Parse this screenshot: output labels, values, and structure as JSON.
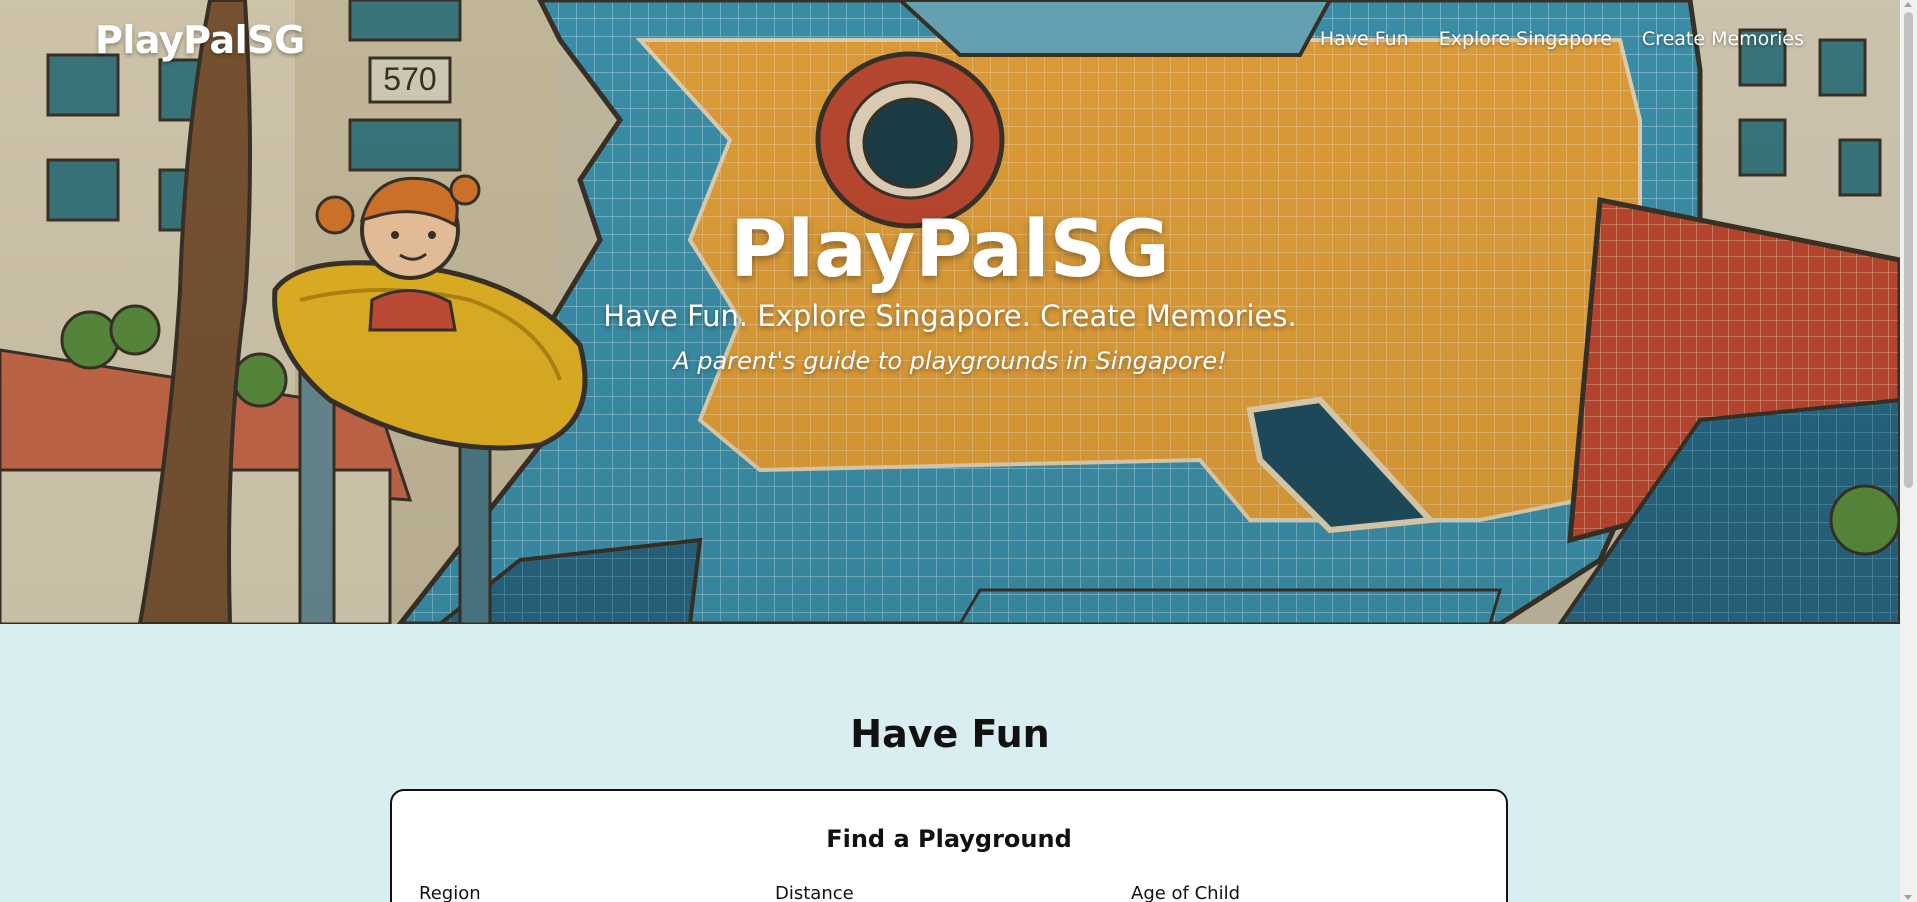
{
  "nav": {
    "brand": "PlayPalSG",
    "links": [
      "Have Fun",
      "Explore Singapore",
      "Create Memories"
    ]
  },
  "hero": {
    "title": "PlayPalSG",
    "subtitle": "Have Fun. Explore Singapore. Create Memories.",
    "tagline": "A parent's guide to playgrounds in Singapore!",
    "block_number": "570"
  },
  "have_fun": {
    "heading": "Have Fun",
    "finder": {
      "title": "Find a Playground",
      "labels": [
        "Region",
        "Distance",
        "Age of Child"
      ]
    }
  },
  "colors": {
    "section_bg": "#d9eef1",
    "mosaic_orange": "#e6a23a",
    "mosaic_teal": "#3d93ae",
    "slide_yellow": "#e8b725",
    "mosaic_red": "#c04a32"
  }
}
